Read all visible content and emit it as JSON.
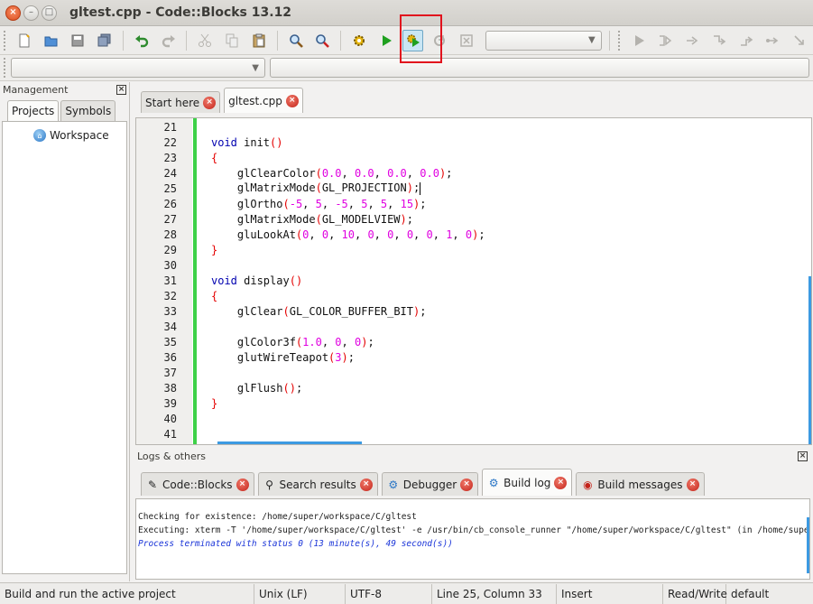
{
  "window": {
    "title": "gltest.cpp - Code::Blocks 13.12",
    "buttons": {
      "close": "×",
      "minimize": "–",
      "maximize": "□"
    }
  },
  "toolbar": {
    "icons": [
      "new-file-icon",
      "open-icon",
      "save-icon",
      "save-all-icon",
      "undo-icon",
      "redo-icon",
      "cut-icon",
      "copy-icon",
      "paste-icon",
      "find-icon",
      "replace-icon",
      "build-icon",
      "run-icon",
      "build-and-run-icon",
      "rebuild-icon",
      "abort-icon",
      "debug-icon",
      "run-to-cursor-icon",
      "next-line-icon",
      "step-into-icon",
      "step-out-icon",
      "next-instruction-icon",
      "step-into-instruction-icon"
    ],
    "build_target_value": "",
    "scope_combo_value": "",
    "function_combo_value": "",
    "highlighted_button": "build-and-run",
    "highlight_color": "#e1121d"
  },
  "management": {
    "title": "Management",
    "tabs": [
      "Projects",
      "Symbols"
    ],
    "active_tab": "Projects",
    "tree": {
      "root": "Workspace"
    }
  },
  "editor": {
    "tabs": [
      {
        "label": "Start here",
        "active": false
      },
      {
        "label": "gltest.cpp",
        "active": true
      }
    ],
    "lines": [
      {
        "n": "21",
        "code": ""
      },
      {
        "n": "22",
        "code": "void init()"
      },
      {
        "n": "23",
        "code": "{"
      },
      {
        "n": "24",
        "code": "    glClearColor(0.0, 0.0, 0.0, 0.0);"
      },
      {
        "n": "25",
        "code": "    glMatrixMode(GL_PROJECTION);"
      },
      {
        "n": "26",
        "code": "    glOrtho(-5, 5, -5, 5, 5, 15);"
      },
      {
        "n": "27",
        "code": "    glMatrixMode(GL_MODELVIEW);"
      },
      {
        "n": "28",
        "code": "    gluLookAt(0, 0, 10, 0, 0, 0, 0, 1, 0);"
      },
      {
        "n": "29",
        "code": "}"
      },
      {
        "n": "30",
        "code": ""
      },
      {
        "n": "31",
        "code": "void display()"
      },
      {
        "n": "32",
        "code": "{"
      },
      {
        "n": "33",
        "code": "    glClear(GL_COLOR_BUFFER_BIT);"
      },
      {
        "n": "34",
        "code": ""
      },
      {
        "n": "35",
        "code": "    glColor3f(1.0, 0, 0);"
      },
      {
        "n": "36",
        "code": "    glutWireTeapot(3);"
      },
      {
        "n": "37",
        "code": ""
      },
      {
        "n": "38",
        "code": "    glFlush();"
      },
      {
        "n": "39",
        "code": "}"
      },
      {
        "n": "40",
        "code": ""
      },
      {
        "n": "41",
        "code": ""
      }
    ],
    "colors": {
      "keyword": "#0000b0",
      "number": "#e000e0",
      "brace": "#e40000",
      "changebar": "#3ed148"
    }
  },
  "logs": {
    "title": "Logs & others",
    "tabs": [
      {
        "label": "Code::Blocks",
        "icon": "pencil-icon",
        "active": false
      },
      {
        "label": "Search results",
        "icon": "magnifier-icon",
        "active": false
      },
      {
        "label": "Debugger",
        "icon": "debugger-icon",
        "active": false
      },
      {
        "label": "Build log",
        "icon": "gear-icon",
        "active": true
      },
      {
        "label": "Build messages",
        "icon": "pin-icon",
        "active": false
      }
    ],
    "build_log": [
      "Checking for existence: /home/super/workspace/C/gltest",
      "Executing: xterm -T '/home/super/workspace/C/gltest' -e /usr/bin/cb_console_runner \"/home/super/workspace/C/gltest\" (in /home/super/workspace/C)",
      "Process terminated with status 0 (13 minute(s), 49 second(s))"
    ]
  },
  "statusbar": {
    "message": "Build and run the active project",
    "eol": "Unix (LF)",
    "encoding": "UTF-8",
    "position": "Line 25, Column 33",
    "mode": "Insert",
    "access": "Read/Write",
    "profile": "default"
  }
}
